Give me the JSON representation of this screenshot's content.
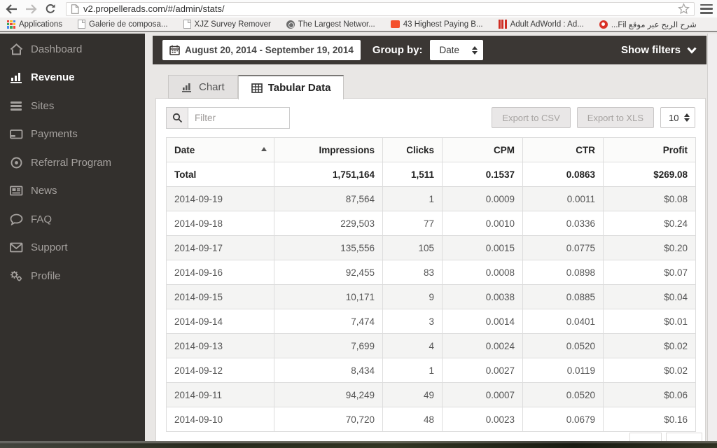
{
  "colors": {
    "sidebar_bg": "#33302d",
    "topbar_bg": "#3b3734",
    "row_stripe": "#f4f4f3",
    "bookmark_red": "#d93025",
    "bookmark_orange": "#f4502c"
  },
  "browser": {
    "url": "v2.propellerads.com/#/admin/stats/",
    "bookmarks": [
      {
        "label": "Applications",
        "icon": "apps-grid-icon"
      },
      {
        "label": "Galerie de composa...",
        "icon": "page-icon"
      },
      {
        "label": "XJZ Survey Remover",
        "icon": "page-icon"
      },
      {
        "label": "The Largest Networ...",
        "icon": "globe-icon"
      },
      {
        "label": "43 Highest Paying B...",
        "icon": "orange-bubble-icon"
      },
      {
        "label": "Adult AdWorld : Ad...",
        "icon": "red-stripes-icon"
      },
      {
        "label": "شرح الربح عبر موقع Fil...",
        "icon": "red-circle-icon"
      }
    ]
  },
  "sidebar": {
    "items": [
      {
        "label": "Dashboard",
        "icon": "home-icon",
        "active": false
      },
      {
        "label": "Revenue",
        "icon": "bar-chart-icon",
        "active": true
      },
      {
        "label": "Sites",
        "icon": "list-icon",
        "active": false
      },
      {
        "label": "Payments",
        "icon": "credit-card-icon",
        "active": false
      },
      {
        "label": "Referral Program",
        "icon": "referral-icon",
        "active": false
      },
      {
        "label": "News",
        "icon": "newspaper-icon",
        "active": false
      },
      {
        "label": "FAQ",
        "icon": "comment-icon",
        "active": false
      },
      {
        "label": "Support",
        "icon": "envelope-icon",
        "active": false
      },
      {
        "label": "Profile",
        "icon": "gears-icon",
        "active": false
      }
    ]
  },
  "topbar": {
    "date_range": "August 20, 2014 - September 19, 2014",
    "group_by_label": "Group by:",
    "group_by_value": "Date",
    "show_filters_label": "Show filters"
  },
  "tabs": [
    {
      "label": "Chart",
      "active": false
    },
    {
      "label": "Tabular Data",
      "active": true
    }
  ],
  "toolbar": {
    "filter_placeholder": "Filter",
    "export_csv_label": "Export to CSV",
    "export_xls_label": "Export to XLS",
    "page_size": "10"
  },
  "table": {
    "columns": [
      "Date",
      "Impressions",
      "Clicks",
      "CPM",
      "CTR",
      "Profit"
    ],
    "sorted_by": "Date ascending",
    "total": {
      "date": "Total",
      "impressions": "1,751,164",
      "clicks": "1,511",
      "cpm": "0.1537",
      "ctr": "0.0863",
      "profit": "$269.08"
    },
    "rows": [
      {
        "date": "2014-09-19",
        "impressions": "87,564",
        "clicks": "1",
        "cpm": "0.0009",
        "ctr": "0.0011",
        "profit": "$0.08"
      },
      {
        "date": "2014-09-18",
        "impressions": "229,503",
        "clicks": "77",
        "cpm": "0.0010",
        "ctr": "0.0336",
        "profit": "$0.24"
      },
      {
        "date": "2014-09-17",
        "impressions": "135,556",
        "clicks": "105",
        "cpm": "0.0015",
        "ctr": "0.0775",
        "profit": "$0.20"
      },
      {
        "date": "2014-09-16",
        "impressions": "92,455",
        "clicks": "83",
        "cpm": "0.0008",
        "ctr": "0.0898",
        "profit": "$0.07"
      },
      {
        "date": "2014-09-15",
        "impressions": "10,171",
        "clicks": "9",
        "cpm": "0.0038",
        "ctr": "0.0885",
        "profit": "$0.04"
      },
      {
        "date": "2014-09-14",
        "impressions": "7,474",
        "clicks": "3",
        "cpm": "0.0014",
        "ctr": "0.0401",
        "profit": "$0.01"
      },
      {
        "date": "2014-09-13",
        "impressions": "7,699",
        "clicks": "4",
        "cpm": "0.0024",
        "ctr": "0.0520",
        "profit": "$0.02"
      },
      {
        "date": "2014-09-12",
        "impressions": "8,434",
        "clicks": "1",
        "cpm": "0.0027",
        "ctr": "0.0119",
        "profit": "$0.02"
      },
      {
        "date": "2014-09-11",
        "impressions": "94,249",
        "clicks": "49",
        "cpm": "0.0007",
        "ctr": "0.0520",
        "profit": "$0.06"
      },
      {
        "date": "2014-09-10",
        "impressions": "70,720",
        "clicks": "48",
        "cpm": "0.0023",
        "ctr": "0.0679",
        "profit": "$0.16"
      }
    ]
  }
}
